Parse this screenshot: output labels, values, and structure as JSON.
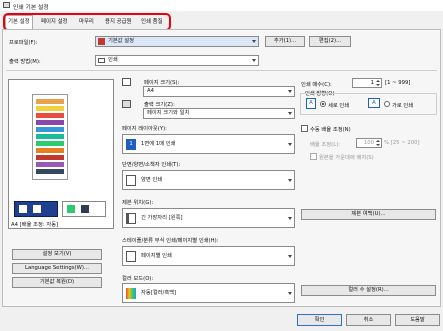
{
  "window": {
    "title": "인쇄 기본 설정"
  },
  "tabs": [
    {
      "label": "기본 설정"
    },
    {
      "label": "페이지 설정"
    },
    {
      "label": "마무리"
    },
    {
      "label": "용지 공급원"
    },
    {
      "label": "인쇄 품질"
    }
  ],
  "profile": {
    "label": "프로파일(F):",
    "value": "기본값 설정",
    "add_button": "추가(1)...",
    "edit_button": "편집(2)..."
  },
  "output_method": {
    "label": "출력 방법(M):",
    "value": "인쇄"
  },
  "page_size": {
    "label": "페이지 크기(S):",
    "value": "A4"
  },
  "output_size": {
    "label": "출력 크기(Z):",
    "value": "페이지 크기와 일치"
  },
  "copies": {
    "label": "인쇄 매수(C):",
    "value": "1",
    "range": "[1 ~ 999]"
  },
  "orientation": {
    "label": "인쇄 방향(O)",
    "portrait": "세로 인쇄",
    "landscape": "가로 인쇄",
    "selected": "portrait"
  },
  "page_layout": {
    "label": "페이지 레이아웃(Y):",
    "value": "1면에 1매 인쇄"
  },
  "manual_scaling": {
    "label": "수동 배율 조정(N)",
    "checked": false,
    "scale_label": "배율 조정(L):",
    "scale_value": "100",
    "scale_range": "% [25 ~ 200]",
    "fit_label": "원본을 가운데에 배치(S)"
  },
  "duplex": {
    "label": "단면/양면/소책자 인쇄(T):",
    "value": "양면 인쇄"
  },
  "binding": {
    "label": "제본 위치(G):",
    "value": "긴 가장자리 [왼쪽]",
    "margin_button": "제본 여백(U)..."
  },
  "stapling": {
    "label": "스테이플/분류 부식 인쇄/페이지별 인쇄(H):",
    "value": "페이지별 인쇄"
  },
  "color_mode": {
    "label": "컬러 모드(O):",
    "value": "자동[컬러/흑백]",
    "color_button": "컬러 수 설정(R)..."
  },
  "preview": {
    "caption": "A4 [배율 조정: 자동]"
  },
  "left_buttons": {
    "view_settings": "설정 보기(V)",
    "language_settings": "Language Settings(W)...",
    "restore_defaults": "기본값 복원(D)"
  },
  "bottom_buttons": {
    "ok": "확인",
    "cancel": "취소",
    "help": "도움말"
  },
  "colors": {
    "highlight": "#e60012",
    "accent": "#1f5fbf"
  }
}
